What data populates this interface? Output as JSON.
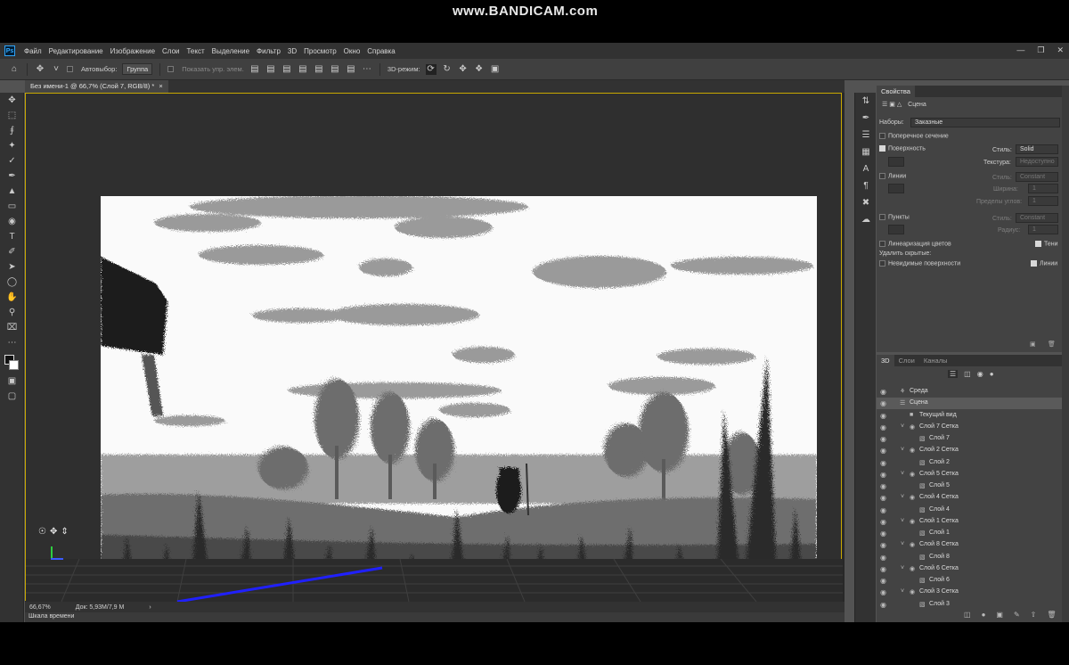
{
  "watermark": "www.BANDICAM.com",
  "menu": [
    "Файл",
    "Редактирование",
    "Изображение",
    "Слои",
    "Текст",
    "Выделение",
    "Фильтр",
    "3D",
    "Просмотр",
    "Окно",
    "Справка"
  ],
  "options": {
    "autoselect_label": "Автовыбор:",
    "autoselect_value": "Группа",
    "show_controls": "Показать упр. элем.",
    "mode3d_label": "3D-режим:"
  },
  "document": {
    "tab_title": "Без имени-1 @ 66,7% (Слой 7, RGB/8) *",
    "zoom": "66,67%",
    "doc_size": "Док: 5,93M/7,9 M",
    "timeline_label": "Шкала времени"
  },
  "properties": {
    "tab": "Свойства",
    "scene_label": "Сцена",
    "presets_label": "Наборы:",
    "presets_value": "Заказные",
    "cross_section": "Поперечное сечение",
    "surface": "Поверхность",
    "style_label": "Стиль:",
    "style_value": "Solid",
    "texture_label": "Текстура:",
    "texture_value": "Недоступно",
    "lines": "Линии",
    "lines_style_value": "Constant",
    "width_label": "Ширина:",
    "width_value": "1",
    "angle_label": "Пределы углов:",
    "angle_value": "1",
    "points": "Пункты",
    "points_style_value": "Constant",
    "radius_label": "Радиус:",
    "radius_value": "1",
    "linearize": "Линеаризация цветов",
    "shadows": "Тени",
    "remove_hidden": "Удалить скрытые:",
    "invisible_surfaces": "Невидимые поверхности",
    "lines_check": "Линии"
  },
  "layers_panel": {
    "tabs": [
      "3D",
      "Слои",
      "Каналы"
    ],
    "items": [
      {
        "label": "Среда",
        "level": 0,
        "type": "env"
      },
      {
        "label": "Сцена",
        "level": 0,
        "type": "scene",
        "selected": true
      },
      {
        "label": "Текущий вид",
        "level": 1,
        "type": "camera"
      },
      {
        "label": "Слой 7 Сетка",
        "level": 1,
        "type": "mesh"
      },
      {
        "label": "Слой 7",
        "level": 2,
        "type": "mat"
      },
      {
        "label": "Слой 2 Сетка",
        "level": 1,
        "type": "mesh"
      },
      {
        "label": "Слой 2",
        "level": 2,
        "type": "mat"
      },
      {
        "label": "Слой 5 Сетка",
        "level": 1,
        "type": "mesh"
      },
      {
        "label": "Слой 5",
        "level": 2,
        "type": "mat"
      },
      {
        "label": "Слой 4 Сетка",
        "level": 1,
        "type": "mesh"
      },
      {
        "label": "Слой 4",
        "level": 2,
        "type": "mat"
      },
      {
        "label": "Слой 1 Сетка",
        "level": 1,
        "type": "mesh"
      },
      {
        "label": "Слой 1",
        "level": 2,
        "type": "mat"
      },
      {
        "label": "Слой 8 Сетка",
        "level": 1,
        "type": "mesh"
      },
      {
        "label": "Слой 8",
        "level": 2,
        "type": "mat"
      },
      {
        "label": "Слой 6 Сетка",
        "level": 1,
        "type": "mesh"
      },
      {
        "label": "Слой 6",
        "level": 2,
        "type": "mat"
      },
      {
        "label": "Слой 3 Сетка",
        "level": 1,
        "type": "mesh"
      },
      {
        "label": "Слой 3",
        "level": 2,
        "type": "mat"
      }
    ]
  },
  "colors": {
    "accent_border": "#c8a800",
    "app_bg": "#535353",
    "panel": "#434343",
    "dark": "#323232",
    "axis_line": "#2020ff"
  }
}
